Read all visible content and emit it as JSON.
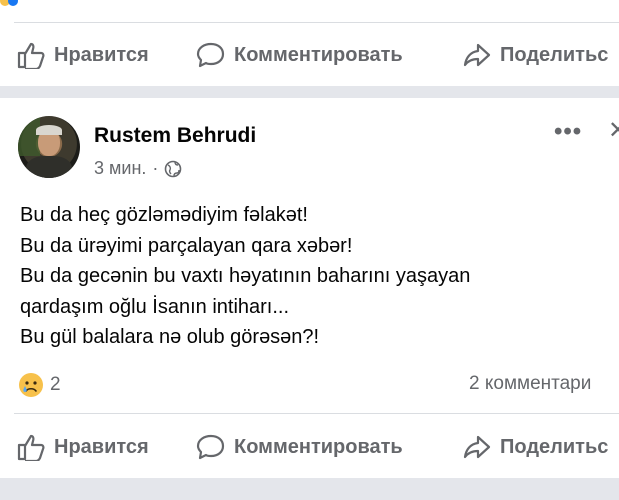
{
  "top_actions": {
    "like_label": "Нравится",
    "comment_label": "Комментировать",
    "share_label": "Поделитьс"
  },
  "post": {
    "author": "Rustem Behrudi",
    "time": "3 мин.",
    "separator": "·",
    "text_lines": [
      "Bu da heç gözləmədiyim fəlakət!",
      "Bu da ürəyimi parçalayan qara xəbər!",
      "Bu da gecənin bu vaxtı həyatının baharını yaşayan",
      "qardaşım oğlu İsanın intiharı...",
      "Bu gül balalara nə olub görəsən?!"
    ],
    "reaction_icon": "sad-emoji",
    "reaction_count": "2",
    "comments_count": "2 комментари"
  },
  "bottom_actions": {
    "like_label": "Нравится",
    "comment_label": "Комментировать",
    "share_label": "Поделитьс"
  },
  "colors": {
    "secondary_text": "#65676b",
    "divider": "#dadde1",
    "feed_gap": "#e4e6eb",
    "primary_text": "#050505"
  }
}
